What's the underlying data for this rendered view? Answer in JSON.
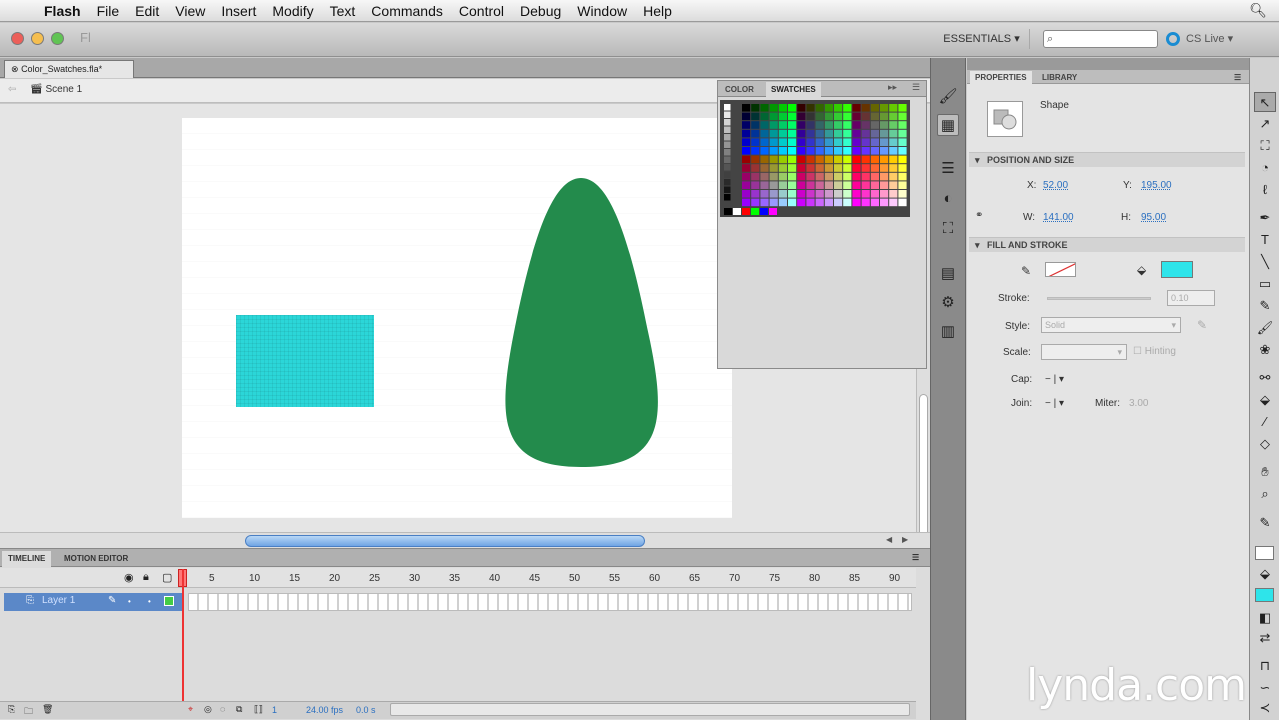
{
  "menubar": {
    "app": "Flash",
    "items": [
      "File",
      "Edit",
      "View",
      "Insert",
      "Modify",
      "Text",
      "Commands",
      "Control",
      "Debug",
      "Window",
      "Help"
    ]
  },
  "appbar": {
    "workspace": "ESSENTIALS ▾",
    "search_placeholder": "",
    "cs_live": "CS Live ▾",
    "fl_glyph": "Fl"
  },
  "document": {
    "tab": "Color_Swatches.fla*",
    "scene": "Scene 1"
  },
  "stage": {
    "rect_color": "#2bd6d8",
    "drop_color": "#238b4c"
  },
  "swatches_panel": {
    "tabs": [
      "COLOR",
      "SWATCHES"
    ],
    "active_tab": "SWATCHES"
  },
  "properties": {
    "tabs": [
      "PROPERTIES",
      "LIBRARY"
    ],
    "type_label": "Shape",
    "sections": {
      "position": "POSITION AND SIZE",
      "fill": "FILL AND STROKE"
    },
    "x_label": "X:",
    "x": "52.00",
    "y_label": "Y:",
    "y": "195.00",
    "w_label": "W:",
    "w": "141.00",
    "h_label": "H:",
    "h": "95.00",
    "stroke_label": "Stroke:",
    "stroke": "0.10",
    "style_label": "Style:",
    "style": "Solid",
    "scale_label": "Scale:",
    "hinting": "Hinting",
    "cap_label": "Cap:",
    "cap": "− | ▾",
    "join_label": "Join:",
    "join": "− | ▾",
    "miter_label": "Miter:",
    "miter": "3.00",
    "fill_color": "#2ee4ea"
  },
  "timeline": {
    "tabs": [
      "TIMELINE",
      "MOTION EDITOR"
    ],
    "layer": "Layer 1",
    "ticks": [
      "5",
      "10",
      "15",
      "20",
      "25",
      "30",
      "35",
      "40",
      "45",
      "50",
      "55",
      "60",
      "65",
      "70",
      "75",
      "80",
      "85",
      "90"
    ],
    "frame": "1",
    "fps": "24.00 fps",
    "time": "0.0 s"
  },
  "watermark": "lynda.com"
}
